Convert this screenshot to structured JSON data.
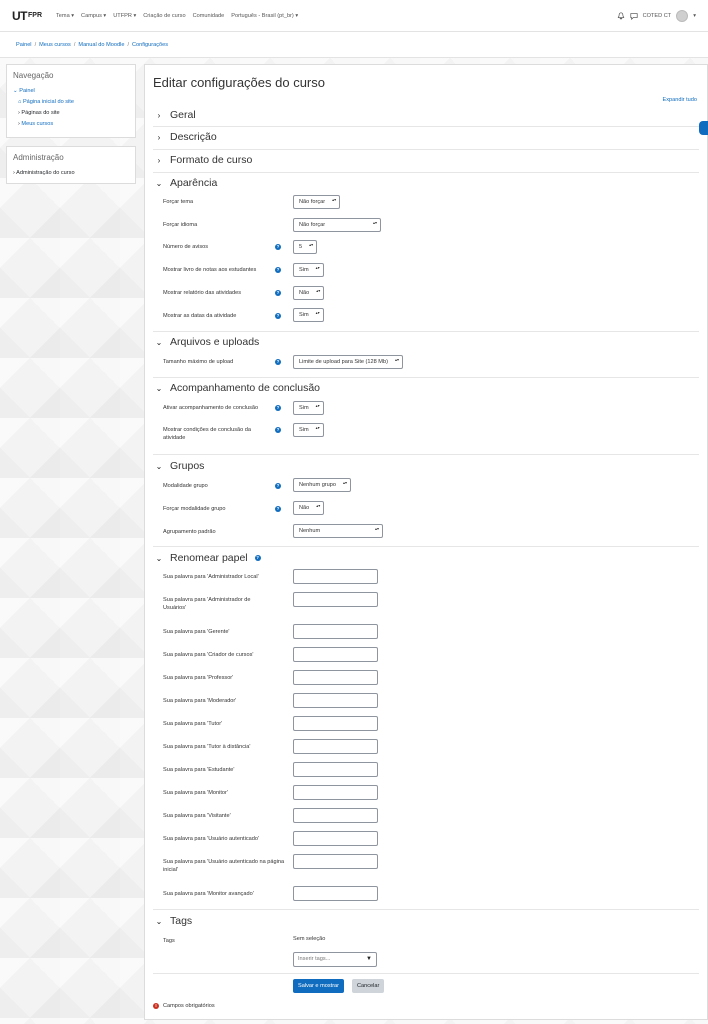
{
  "navbar": {
    "logo_main": "UT",
    "logo_sub": "FPR",
    "menu": [
      "Tema ▾",
      "Campus ▾",
      "UTFPR ▾",
      "Criação de curso",
      "Comunidade",
      "Português - Brasil (pt_br) ▾"
    ],
    "user_name": "COTED CT"
  },
  "breadcrumb": [
    "Painel",
    "Meus cursos",
    "Manual do Moodle",
    "Configurações"
  ],
  "nav_block": {
    "title": "Navegação",
    "items": [
      "Painel",
      "Página inicial do site",
      "Páginas do site",
      "Meus cursos"
    ]
  },
  "admin_block": {
    "title": "Administração",
    "items": [
      "Administração do curso"
    ]
  },
  "main": {
    "heading": "Editar configurações do curso",
    "expand_all": "Expandir tudo"
  },
  "sections": {
    "geral": "Geral",
    "descricao": "Descrição",
    "formato": "Formato de curso",
    "aparencia": "Aparência",
    "arquivos": "Arquivos e uploads",
    "conclusao": "Acompanhamento de conclusão",
    "grupos": "Grupos",
    "renomear": "Renomear papel",
    "tags": "Tags"
  },
  "aparencia": {
    "forcar_tema": {
      "label": "Forçar tema",
      "value": "Não forçar"
    },
    "forcar_idioma": {
      "label": "Forçar idioma",
      "value": "Não forçar"
    },
    "num_avisos": {
      "label": "Número de avisos",
      "value": "5"
    },
    "livro_notas": {
      "label": "Mostrar livro de notas aos estudantes",
      "value": "Sim"
    },
    "relatorio": {
      "label": "Mostrar relatório das atividades",
      "value": "Não"
    },
    "datas": {
      "label": "Mostrar as datas da atividade",
      "value": "Sim"
    }
  },
  "arquivos": {
    "upload": {
      "label": "Tamanho máximo de upload",
      "value": "Limite de upload para Site (128 Mb)"
    }
  },
  "conclusao": {
    "ativar": {
      "label": "Ativar acompanhamento de conclusão",
      "value": "Sim"
    },
    "condicoes": {
      "label": "Mostrar condições de conclusão da atividade",
      "value": "Sim"
    }
  },
  "grupos": {
    "modalidade": {
      "label": "Modalidade grupo",
      "value": "Nenhum grupo"
    },
    "forcar": {
      "label": "Forçar modalidade grupo",
      "value": "Não"
    },
    "agrupamento": {
      "label": "Agrupamento padrão",
      "value": "Nenhum"
    }
  },
  "renomear": {
    "labels": [
      "Sua palavra para 'Administrador Local'",
      "Sua palavra para 'Administrador de Usuários'",
      "Sua palavra para 'Gerente'",
      "Sua palavra para 'Criador de cursos'",
      "Sua palavra para 'Professor'",
      "Sua palavra para 'Moderador'",
      "Sua palavra para 'Tutor'",
      "Sua palavra para 'Tutor à distância'",
      "Sua palavra para 'Estudante'",
      "Sua palavra para 'Monitor'",
      "Sua palavra para 'Visitante'",
      "Sua palavra para 'Usuário autenticado'",
      "Sua palavra para 'Usuário autenticado na página inicial'",
      "Sua palavra para 'Monitor avançado'"
    ]
  },
  "tags": {
    "label": "Tags",
    "none_selected": "Sem seleção",
    "placeholder": "Inserir tags..."
  },
  "buttons": {
    "save": "Salvar e mostrar",
    "cancel": "Cancelar"
  },
  "required_note": "Campos obrigatórios",
  "colors": {
    "link": "#0f6cbf",
    "primary": "#0f6cbf",
    "required": "#ca3120"
  }
}
